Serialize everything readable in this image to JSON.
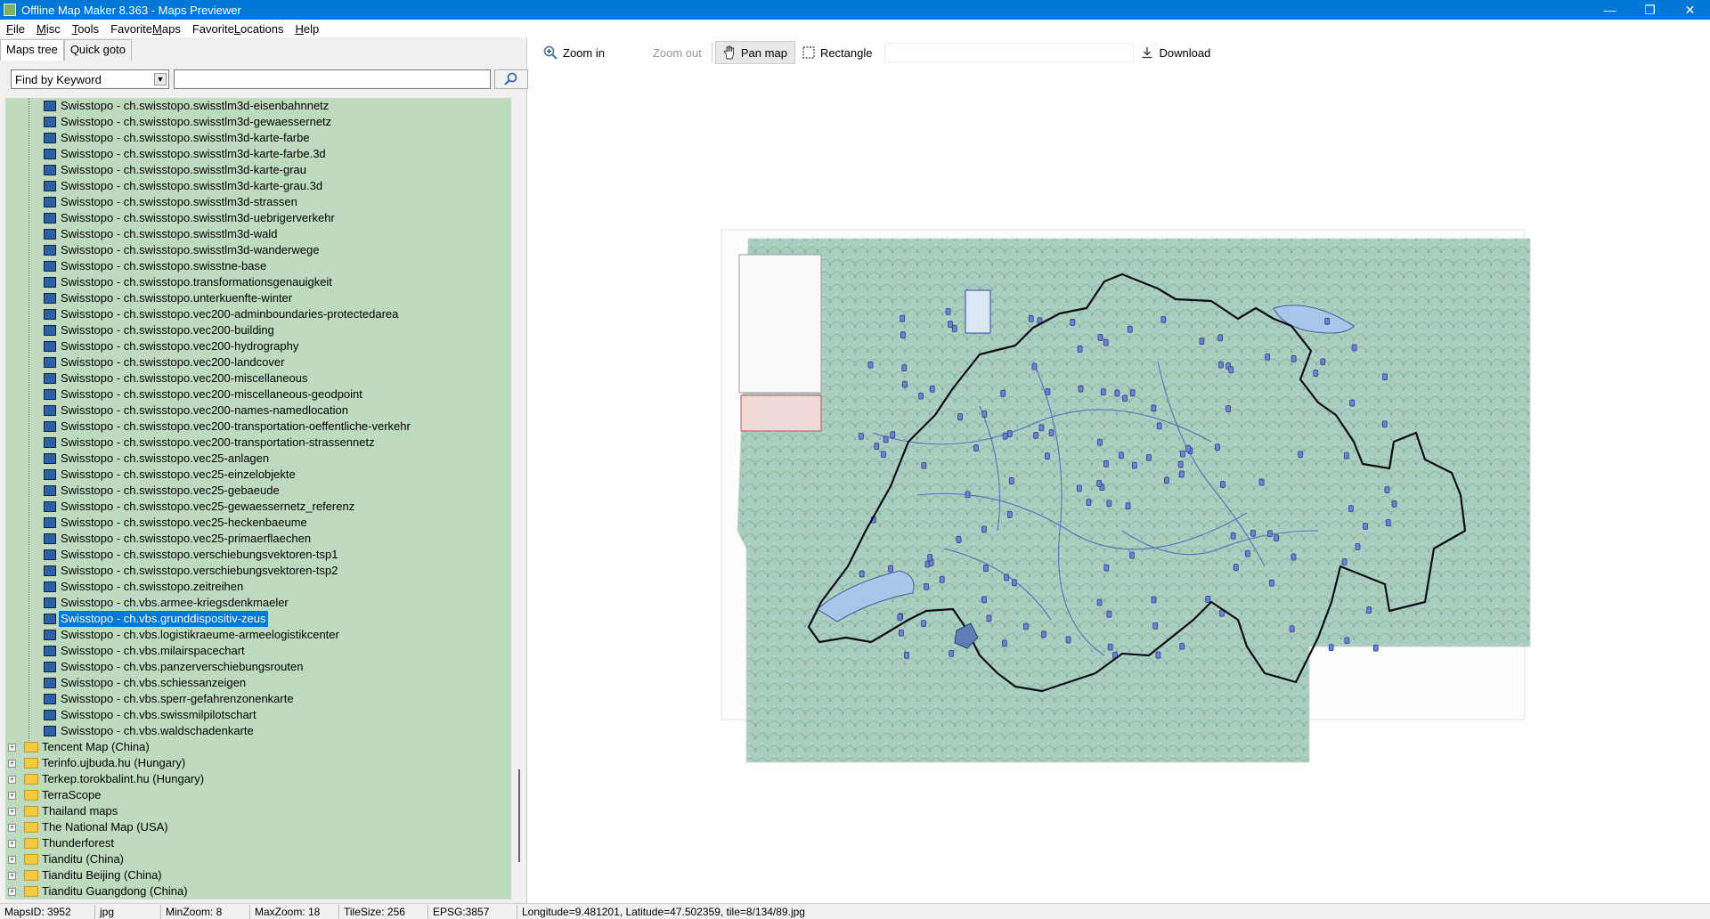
{
  "window": {
    "title": "Offline Map Maker 8.363 - Maps Previewer",
    "min_glyph": "—",
    "max_glyph": "❐",
    "close_glyph": "✕"
  },
  "menu": [
    {
      "label": "File",
      "ul": "F",
      "rest": "ile"
    },
    {
      "label": "Misc",
      "ul": "M",
      "rest": "isc"
    },
    {
      "label": "Tools",
      "ul": "T",
      "rest": "ools"
    },
    {
      "label": "FavoriteMaps",
      "pre": "Favorite",
      "ul": "M",
      "rest": "aps"
    },
    {
      "label": "FavoriteLocations",
      "pre": "Favorite",
      "ul": "L",
      "rest": "ocations"
    },
    {
      "label": "Help",
      "ul": "H",
      "rest": "elp"
    }
  ],
  "left": {
    "tabs": [
      "Maps tree",
      "Quick goto"
    ],
    "find_select": "Find by Keyword",
    "search_value": "",
    "tree_leaves": [
      "Swisstopo - ch.swisstopo.swisstlm3d-eisenbahnnetz",
      "Swisstopo - ch.swisstopo.swisstlm3d-gewaessernetz",
      "Swisstopo - ch.swisstopo.swisstlm3d-karte-farbe",
      "Swisstopo - ch.swisstopo.swisstlm3d-karte-farbe.3d",
      "Swisstopo - ch.swisstopo.swisstlm3d-karte-grau",
      "Swisstopo - ch.swisstopo.swisstlm3d-karte-grau.3d",
      "Swisstopo - ch.swisstopo.swisstlm3d-strassen",
      "Swisstopo - ch.swisstopo.swisstlm3d-uebrigerverkehr",
      "Swisstopo - ch.swisstopo.swisstlm3d-wald",
      "Swisstopo - ch.swisstopo.swisstlm3d-wanderwege",
      "Swisstopo - ch.swisstopo.swisstne-base",
      "Swisstopo - ch.swisstopo.transformationsgenauigkeit",
      "Swisstopo - ch.swisstopo.unterkuenfte-winter",
      "Swisstopo - ch.swisstopo.vec200-adminboundaries-protectedarea",
      "Swisstopo - ch.swisstopo.vec200-building",
      "Swisstopo - ch.swisstopo.vec200-hydrography",
      "Swisstopo - ch.swisstopo.vec200-landcover",
      "Swisstopo - ch.swisstopo.vec200-miscellaneous",
      "Swisstopo - ch.swisstopo.vec200-miscellaneous-geodpoint",
      "Swisstopo - ch.swisstopo.vec200-names-namedlocation",
      "Swisstopo - ch.swisstopo.vec200-transportation-oeffentliche-verkehr",
      "Swisstopo - ch.swisstopo.vec200-transportation-strassennetz",
      "Swisstopo - ch.swisstopo.vec25-anlagen",
      "Swisstopo - ch.swisstopo.vec25-einzelobjekte",
      "Swisstopo - ch.swisstopo.vec25-gebaeude",
      "Swisstopo - ch.swisstopo.vec25-gewaessernetz_referenz",
      "Swisstopo - ch.swisstopo.vec25-heckenbaeume",
      "Swisstopo - ch.swisstopo.vec25-primaerflaechen",
      "Swisstopo - ch.swisstopo.verschiebungsvektoren-tsp1",
      "Swisstopo - ch.swisstopo.verschiebungsvektoren-tsp2",
      "Swisstopo - ch.swisstopo.zeitreihen",
      "Swisstopo - ch.vbs.armee-kriegsdenkmaeler",
      "Swisstopo - ch.vbs.grunddispositiv-zeus",
      "Swisstopo - ch.vbs.logistikraeume-armeelogistikcenter",
      "Swisstopo - ch.vbs.milairspacechart",
      "Swisstopo - ch.vbs.panzerverschiebungsrouten",
      "Swisstopo - ch.vbs.schiessanzeigen",
      "Swisstopo - ch.vbs.sperr-gefahrenzonenkarte",
      "Swisstopo - ch.vbs.swissmilpilotschart",
      "Swisstopo - ch.vbs.waldschadenkarte"
    ],
    "selected_index": 32,
    "tree_folders": [
      "Tencent Map (China)",
      "Terinfo.ujbuda.hu (Hungary)",
      "Terkep.torokbalint.hu (Hungary)",
      "TerraScope",
      "Thailand maps",
      "The National Map (USA)",
      "Thunderforest",
      "Tianditu (China)",
      "Tianditu Beijing (China)",
      "Tianditu Guangdong (China)"
    ],
    "expander_glyph": "+"
  },
  "toolbar": {
    "zoom_in": "Zoom in",
    "zoom_out": "Zoom out",
    "pan_map": "Pan map",
    "rectangle": "Rectangle",
    "download": "Download"
  },
  "status": {
    "maps_id": "MapsID: 3952",
    "format": "jpg",
    "min_zoom": "MinZoom: 8",
    "max_zoom": "MaxZoom: 18",
    "tile_size": "TileSize: 256",
    "epsg": "EPSG:3857",
    "coords": "Longitude=9.481201, Latitude=47.502359, tile=8/134/89.jpg"
  },
  "colors": {
    "accent": "#0078d7",
    "tree_bg": "#bedbbf",
    "border_line": "#111111",
    "map_terrain": "#a9cdbf"
  }
}
